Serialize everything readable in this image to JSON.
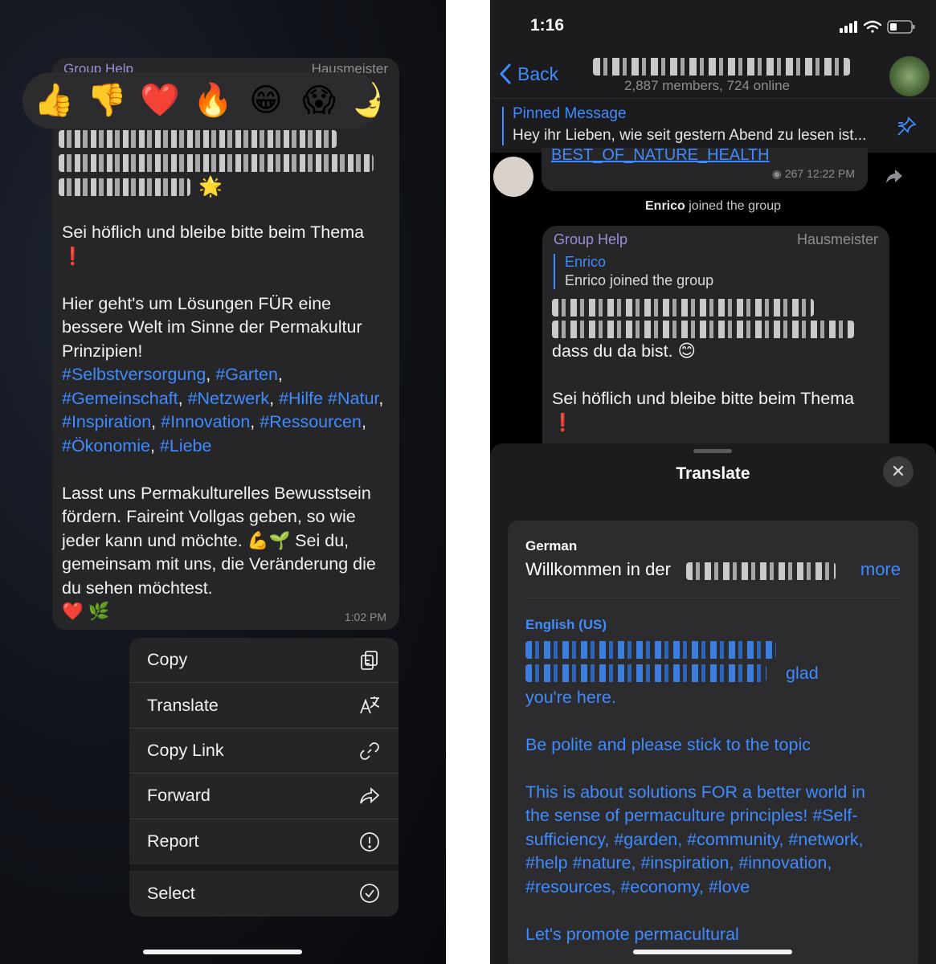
{
  "left": {
    "header": {
      "group_name": "Group Help",
      "role": "Hausmeister"
    },
    "reactions": [
      "👍",
      "👎",
      "❤️",
      "🔥",
      "😁",
      "😱",
      "🌛"
    ],
    "message": {
      "p1_emoji": "🌟",
      "p2": "Sei höflich und bleibe bitte beim Thema ❗",
      "p3_lead": "Hier geht's um Lösungen FÜR eine bessere Welt im Sinne der Permakultur Prinzipien!",
      "tags": [
        "#Selbstversorgung",
        "#Garten",
        "#Gemeinschaft",
        "#Netzwerk",
        "#Hilfe",
        "#Natur",
        "#Inspiration",
        "#Innovation",
        "#Ressourcen",
        "#Ökonomie",
        "#Liebe"
      ],
      "p4": "Lasst uns Permakulturelles Bewusstsein fördern. Faireint Vollgas geben, so wie jeder kann und möchte. 💪🌱 Sei du, gemeinsam mit uns, die Veränderung die du sehen möchtest.",
      "p4_end": "❤️ 🌿",
      "time": "1:02 PM"
    },
    "menu": [
      {
        "label": "Copy",
        "icon": "copy-icon"
      },
      {
        "label": "Translate",
        "icon": "translate-icon"
      },
      {
        "label": "Copy Link",
        "icon": "link-icon"
      },
      {
        "label": "Forward",
        "icon": "forward-icon"
      },
      {
        "label": "Report",
        "icon": "report-icon"
      },
      {
        "label": "Select",
        "icon": "select-icon"
      }
    ]
  },
  "right": {
    "status": {
      "time": "1:16"
    },
    "nav": {
      "back": "Back",
      "members": "2,887 members, 724 online"
    },
    "pinned": {
      "title": "Pinned Message",
      "text": "Hey ihr Lieben, wie seit gestern Abend zu lesen ist..."
    },
    "prev": {
      "link": "BEST_OF_NATURE_HEALTH",
      "views": "267",
      "time": "12:22 PM"
    },
    "system": {
      "name": "Enrico",
      "text": " joined the group"
    },
    "bubble": {
      "group_name": "Group Help",
      "role": "Hausmeister",
      "reply_name": "Enrico",
      "reply_text": "Enrico joined the group",
      "line3": "dass du da bist. 😊",
      "line4": "Sei höflich und bleibe bitte beim Thema ❗"
    },
    "sheet": {
      "title": "Translate",
      "source_lang": "German",
      "source_text": "Willkommen in der",
      "more": "more",
      "target_lang": "English (US)",
      "t1_end": "glad",
      "t1b": "you're here.",
      "t2": "Be polite and please stick to the topic",
      "t3": "This is about solutions FOR a better world in the sense of permaculture principles! #Self-sufficiency, #garden, #community, #network, #help #nature, #inspiration, #innovation, #resources, #economy, #love",
      "t4": "Let's promote permacultural"
    }
  }
}
